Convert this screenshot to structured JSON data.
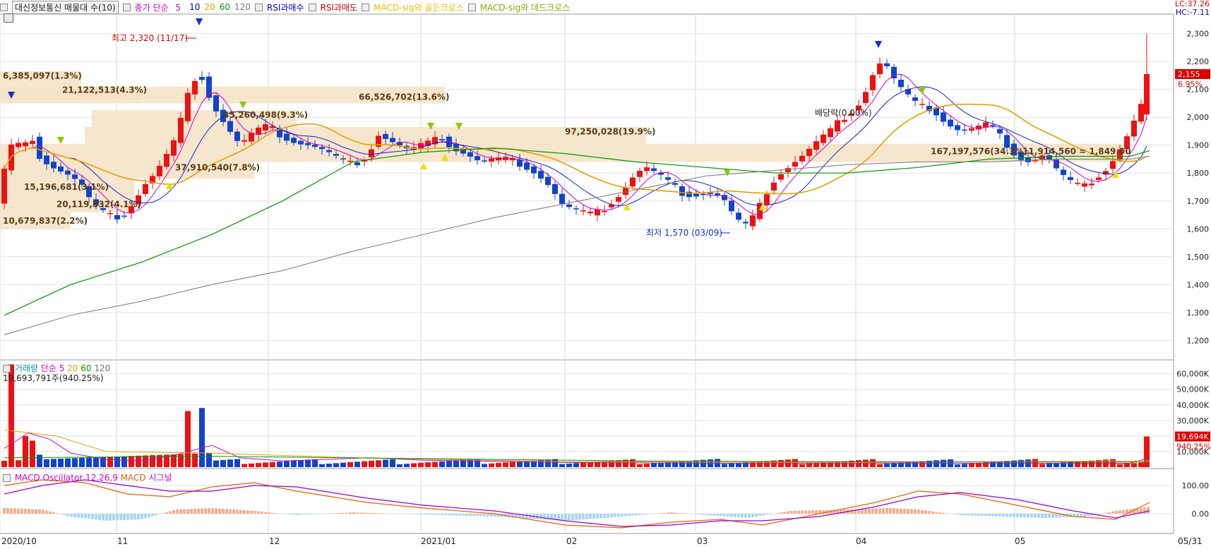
{
  "legend": {
    "stock_title": "대신정보통신 매물대 수(10)",
    "price_ma_label": "종가 단순",
    "ma_periods": [
      "5",
      "10",
      "20",
      "60",
      "120"
    ],
    "ma_colors": [
      "#cc00cc",
      "#0000cc",
      "#e8a000",
      "#009900",
      "#777777"
    ],
    "rsi_buy": "RSI과매수",
    "rsi_sell": "RSI과매도",
    "macd_golden": "MACD-sig와 골든크로스",
    "macd_dead": "MACD-sig와 데드크로스",
    "lc": "LC:37.26",
    "hc": "HC:-7.11"
  },
  "volume_legend": {
    "label": "거래량",
    "ma_label": "단순",
    "ma_periods": [
      "5",
      "20",
      "60",
      "120"
    ],
    "last_volume_text": "19,693,791주(940.25%)"
  },
  "macd_legend": {
    "osc": "MACD Oscillator 12,26,9",
    "macd": "MACD",
    "signal": "시그널"
  },
  "annotations": {
    "high": "최고 2,320 (11/17)",
    "low": "최저 1,570 (03/09)",
    "dividend": "배당락(0.00%)"
  },
  "price_tag": {
    "price": "2,155",
    "change": "6.95%"
  },
  "volume_tag": {
    "volume": "19,694K",
    "pct": "940.25%"
  },
  "chart_data": [
    {
      "type": "candlestick",
      "y_ticks": [
        "2,300",
        "2,200",
        "2,100",
        "2,000",
        "1,900",
        "1,800",
        "1,700",
        "1,600",
        "1,500",
        "1,400",
        "1,300",
        "1,200"
      ],
      "x_labels": [
        "2020/10",
        "11",
        "12",
        "2021/01",
        "02",
        "03",
        "04",
        "05",
        "05/31"
      ],
      "ylim": [
        1130,
        2370
      ],
      "volume_profile": [
        {
          "from": 2050,
          "to": 2110,
          "label": "21,122,513(4.3%)"
        },
        {
          "from": 2110,
          "to": 2165,
          "label": "6,385,097(1.3%)"
        },
        {
          "from": 2050,
          "to": 2110,
          "label": "66,526,702(13.6%)"
        },
        {
          "from": 1965,
          "to": 2025,
          "label": "45,260,498(9.3%)"
        },
        {
          "from": 1905,
          "to": 1965,
          "label": "97,250,028(19.9%)"
        },
        {
          "from": 1840,
          "to": 1905,
          "label": "167,197,576(34.3%)"
        },
        {
          "from": 1780,
          "to": 1840,
          "label": "37,910,540(7.8%)"
        },
        {
          "from": 1720,
          "to": 1780,
          "label": "15,196,681(3.1%)"
        },
        {
          "from": 1660,
          "to": 1720,
          "label": "20,119,832(4.1%)"
        },
        {
          "from": 1600,
          "to": 1660,
          "label": "10,679,837(2.2%)"
        }
      ],
      "extra_profile_label": "11,914,560 = 1,849.00"
    },
    {
      "type": "bar",
      "title": "거래량",
      "y_ticks": [
        "60,000K",
        "50,000K",
        "40,000K",
        "30,000K",
        "20,000K",
        "10,000K"
      ],
      "ylim": [
        0,
        68000
      ]
    },
    {
      "type": "bar",
      "title": "MACD Oscillator 12,26,9",
      "y_ticks": [
        "100.00",
        "0.00"
      ],
      "ylim": [
        -60,
        150
      ]
    }
  ]
}
